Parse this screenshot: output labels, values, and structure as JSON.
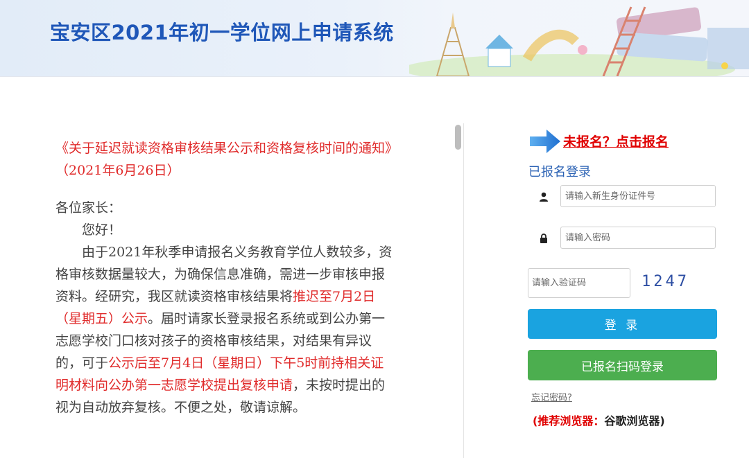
{
  "header": {
    "title": "宝安区2021年初一学位网上申请系统"
  },
  "notice": {
    "title": "《关于延迟就读资格审核结果公示和资格复核时间的通知》（2021年6月26日）",
    "greeting": "各位家长：",
    "hello": "您好！",
    "body_part1": "由于2021年秋季申请报名义务教育学位人数较多，资格审核数据量较大，为确保信息准确，需进一步审核申报资料。经研究，我区就读资格审核结果将",
    "body_red1": "推迟至7月2日（星期五）公示",
    "body_part2": "。届时请家长登录报名系统或到公办第一志愿学校门口核对孩子的资格审核结果，对结果有异议的，可于",
    "body_red2": "公示后至7月4日（星期日）下午5时前持相关证明材料向公办第一志愿学校提出复核申请",
    "body_part3": "，未按时提出的视为自动放弃复核。不便之处，敬请谅解。"
  },
  "login": {
    "register_link": "未报名？点击报名",
    "section_title": "已报名登录",
    "id_placeholder": "请输入新生身份证件号",
    "password_placeholder": "请输入密码",
    "captcha_placeholder": "请输入验证码",
    "captcha_code": "1247",
    "login_button": "登 录",
    "scan_button": "已报名扫码登录",
    "forgot_password": "忘记密码?",
    "browser_label": "(推荐浏览器：",
    "browser_value": "谷歌浏览器)"
  },
  "colors": {
    "title_blue": "#1f57b8",
    "alert_red": "#e02b2b",
    "login_blue": "#1aa3e0",
    "scan_green": "#4cae4f"
  },
  "icons": {
    "user": "user-icon",
    "lock": "lock-icon",
    "arrow": "arrow-right-icon"
  }
}
